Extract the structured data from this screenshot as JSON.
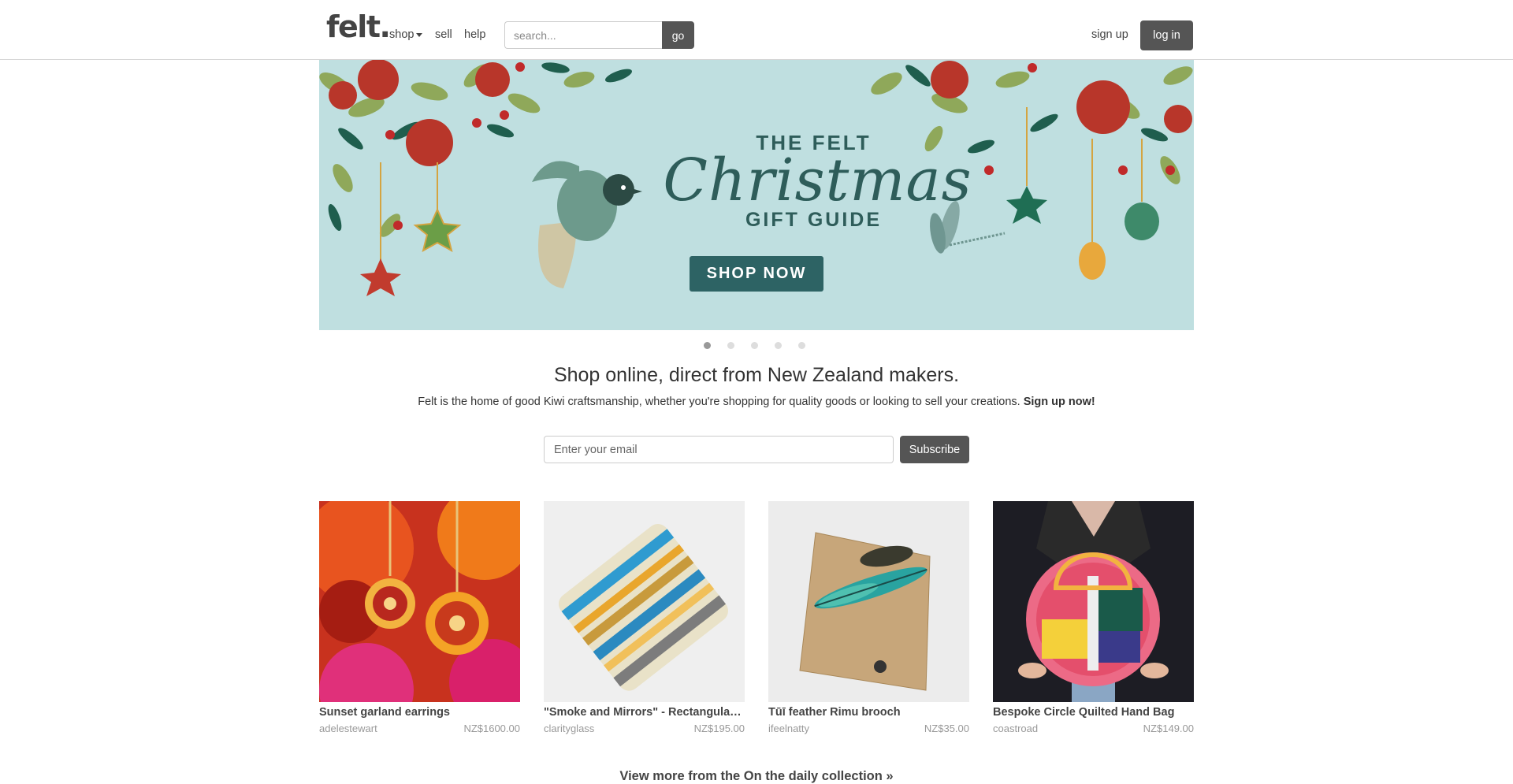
{
  "header": {
    "logo": "felt.",
    "nav": {
      "shop": "shop",
      "sell": "sell",
      "help": "help"
    },
    "search_placeholder": "search...",
    "search_button": "go",
    "signup": "sign up",
    "login": "log in"
  },
  "banner": {
    "line1": "THE FELT",
    "line2": "Christmas",
    "line3": "GIFT GUIDE",
    "cta": "SHOP NOW",
    "active_slide": 1,
    "slide_count": 5
  },
  "intro": {
    "headline": "Shop online, direct from New Zealand makers.",
    "text": "Felt is the home of good Kiwi craftsmanship, whether you're shopping for quality goods or looking to sell your creations.",
    "cta": "Sign up now!",
    "email_placeholder": "Enter your email",
    "subscribe": "Subscribe"
  },
  "products": [
    {
      "title": "Sunset garland earrings",
      "seller": "adelestewart",
      "price": "NZ$1600.00"
    },
    {
      "title": "\"Smoke and Mirrors\" - Rectangular ...",
      "seller": "clarityglass",
      "price": "NZ$195.00"
    },
    {
      "title": "Tūī feather Rimu brooch",
      "seller": "ifeelnatty",
      "price": "NZ$35.00"
    },
    {
      "title": "Bespoke Circle Quilted Hand Bag",
      "seller": "coastroad",
      "price": "NZ$149.00"
    }
  ],
  "view_more": "View more from the On the daily collection »",
  "colors": {
    "button": "#555555",
    "banner_bg": "#bfdfe0",
    "banner_ink": "#2e5d5a"
  }
}
